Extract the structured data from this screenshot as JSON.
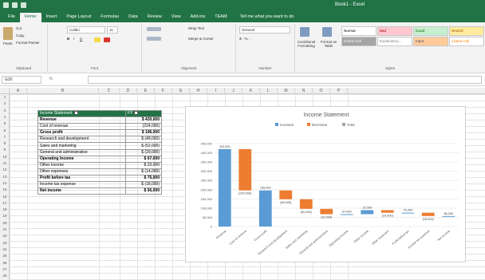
{
  "window": {
    "title": "Book1 - Excel"
  },
  "tabs": [
    "File",
    "Home",
    "Insert",
    "Page Layout",
    "Formulas",
    "Data",
    "Review",
    "View",
    "Add-ins",
    "TEAM"
  ],
  "active_tab": "Home",
  "tell_me": "Tell me what you want to do",
  "ribbon": {
    "clipboard": {
      "label": "Clipboard",
      "paste": "Paste",
      "cut": "Cut",
      "copy": "Copy",
      "format_painter": "Format Painter"
    },
    "font": {
      "label": "Font",
      "name": "Calibri",
      "size": "11"
    },
    "alignment": {
      "label": "Alignment",
      "wrap": "Wrap Text",
      "merge": "Merge & Center"
    },
    "number": {
      "label": "Number",
      "format": "General"
    },
    "styles": {
      "label": "Styles",
      "conditional": "Conditional Formatting",
      "format_table": "Format as Table",
      "cells": [
        {
          "label": "Normal",
          "bg": "#ffffff",
          "fg": "#000000"
        },
        {
          "label": "Bad",
          "bg": "#ffc7ce",
          "fg": "#9c0006"
        },
        {
          "label": "Good",
          "bg": "#c6efce",
          "fg": "#006100"
        },
        {
          "label": "Neutral",
          "bg": "#ffeb9c",
          "fg": "#9c5700"
        },
        {
          "label": "Check Cell",
          "bg": "#a5a5a5",
          "fg": "#ffffff"
        },
        {
          "label": "Explanatory...",
          "bg": "#ffffff",
          "fg": "#7f7f7f"
        },
        {
          "label": "Input",
          "bg": "#ffcc99",
          "fg": "#3f3f76"
        },
        {
          "label": "Linked Cell",
          "bg": "#ffffff",
          "fg": "#fa7d00"
        }
      ]
    }
  },
  "formula_bar": {
    "name_box": "G20",
    "fx": "fx",
    "value": ""
  },
  "columns": [
    "A",
    "B",
    "C",
    "D",
    "E",
    "F",
    "G",
    "H",
    "I",
    "J",
    "K",
    "L",
    "M",
    "N",
    "O",
    "P"
  ],
  "rows": [
    "1",
    "2",
    "3",
    "4",
    "5",
    "6",
    "7",
    "8",
    "9",
    "10",
    "11",
    "12",
    "13",
    "14",
    "15",
    "16",
    "17",
    "18",
    "19",
    "20",
    "21",
    "22",
    "23",
    "24",
    "25",
    "26",
    "27",
    "28"
  ],
  "table": {
    "headers": [
      "Income Statement",
      "FY"
    ],
    "rows": [
      {
        "label": "Revenue",
        "value": "$ 420,000",
        "bold": true
      },
      {
        "label": "Cost of revenue",
        "value": "(224,000)",
        "bold": false
      },
      {
        "label": "Gross profit",
        "value": "$ 196,000",
        "bold": true
      },
      {
        "label": "Research and development",
        "value": "$ (48,000)",
        "bold": false
      },
      {
        "label": "Sales and marketing",
        "value": "$ (52,000)",
        "bold": false
      },
      {
        "label": "General and administrative",
        "value": "$ (29,000)",
        "bold": false
      },
      {
        "label": "Operating Income",
        "value": "$ 67,000",
        "bold": true
      },
      {
        "label": "Other income",
        "value": "$ 22,000",
        "bold": false
      },
      {
        "label": "Other expenses",
        "value": "$ (14,000)",
        "bold": false
      },
      {
        "label": "Profit before tax",
        "value": "$ 75,000",
        "bold": true
      },
      {
        "label": "Income tax expense",
        "value": "$ (18,000)",
        "bold": false
      },
      {
        "label": "Net income",
        "value": "$ 56,000",
        "bold": true
      }
    ]
  },
  "chart_data": {
    "type": "bar",
    "subtype": "waterfall",
    "title": "Income Statement",
    "legend": [
      "Increase",
      "Decrease",
      "Total"
    ],
    "legend_position": "top",
    "colors": {
      "Increase": "#5b9bd5",
      "Decrease": "#ed7d31",
      "Total": "#a5a5a5"
    },
    "ylim": [
      0,
      450000
    ],
    "yticks": [
      "0",
      "50,000",
      "100,000",
      "150,000",
      "200,000",
      "250,000",
      "300,000",
      "350,000",
      "400,000",
      "450,000"
    ],
    "categories": [
      "Revenue",
      "Cost of revenue",
      "Gross profit",
      "Research and development",
      "Sales and marketing",
      "General and administrative",
      "Operating Income",
      "Other income",
      "Other expenses",
      "Profit before tax",
      "Income tax expense",
      "Net income"
    ],
    "values": [
      420000,
      -224000,
      196000,
      -48000,
      -52000,
      -29000,
      67000,
      22000,
      -14000,
      75000,
      -18000,
      56000
    ],
    "data_labels": [
      "420,000",
      "(224,000)",
      "196,000",
      "(48,000)",
      "(52,000)",
      "(29,000)",
      "67,000",
      "22,000",
      "(14,000)",
      "75,000",
      "(18,000)",
      "56,000"
    ]
  }
}
